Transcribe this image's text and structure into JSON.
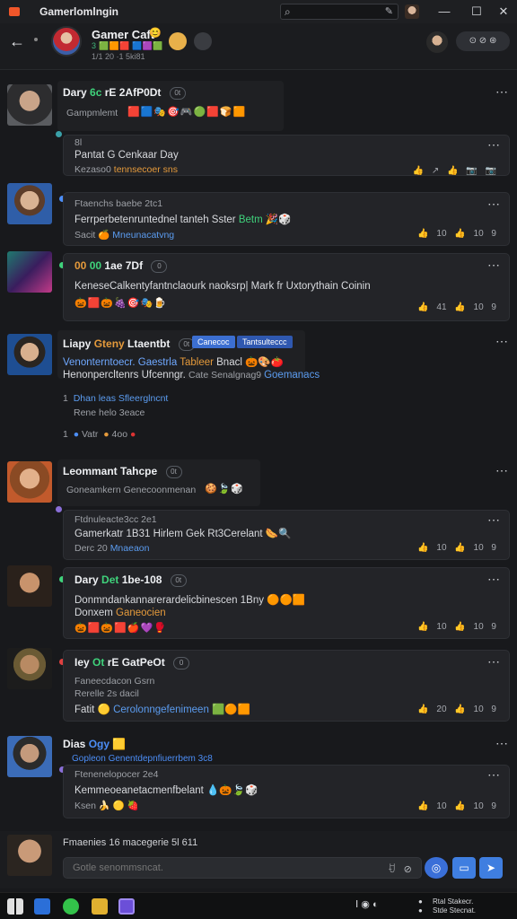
{
  "window": {
    "title": "Gamerlomlngin",
    "search_icon": "search-icon",
    "minimize": "—",
    "maximize": "☐",
    "close": "✕"
  },
  "header": {
    "back": "←",
    "group_name": "Gamer Caft",
    "group_emoji": "😊",
    "group_status": "3 🟩🟧🟥 🟦🟪🟩",
    "group_members": "1/1 20 ·1 5ki81",
    "pill": "⊙ ⊘ ⊛"
  },
  "messages": [
    {
      "name": "Dary",
      "name_green": "6c",
      "name_rest": "rE 2AfP0Dt",
      "time": "0t",
      "text": "Gampmlemt",
      "emojis": "🟥🟦🎭🎯🎮🟢🟥🍞🟧",
      "replies": [
        {
          "meta": "8l",
          "line1": "Pantat  G  Cenkaar  Day",
          "line2": "Kezaso0 ",
          "line2_orange": "tennsecoer sns",
          "reactions": "👍 ↗ 👍 📷 📷"
        }
      ]
    },
    {
      "name": "",
      "text_meta": "Ftaenchs baebe 2tc1",
      "text": "Ferrperbetenruntednel tanteh Sster ",
      "text_green": "Betm",
      "text_emojis": "🎉🎲",
      "sub": "Sacit 🍊 ",
      "sub_blue": "Mneunacatvng",
      "reactions": "👍 10  👍 10  9"
    },
    {
      "name": "00",
      "name_green": "00",
      "name_rest": "1ae 7Df",
      "time": "0",
      "text": "KeneseCalkentyfantnclaourk naoksrp| Mark fr Uxtorythain Coinin",
      "emojis": "🎃🟥🎃🍇🎯🎭🍺",
      "reactions": "👍 41  👍 10  9"
    },
    {
      "name": "Liapy",
      "name_green": "Gteny",
      "name_rest": "Ltaentbt",
      "time": "0t",
      "tags": [
        "Canecoc",
        "Tantsulteccc"
      ],
      "text": "Venonterntoecr. Gaestrla ",
      "text_orange": "Tableer",
      "text_tail": " Bnacl",
      "text_emojis": "🎃🎨🍅",
      "text2": "Henonpercltenrs Ufcenngr. ",
      "text2_gray": "Cate Senalgnag9 ",
      "text2_blue": "Goemanacs",
      "line3_num": "1",
      "line3": "Dhan leas Sfleerglncnt",
      "line4": "Rene helo 3eace",
      "line5_num": "1",
      "line5_a": "Vatr",
      "line5_b": "4oo"
    },
    {
      "name": "Leommant",
      "name_rest": "Tahcpe",
      "time": "0t",
      "text": "Goneamkern Genecoonmenan",
      "emojis": "🍪🍃🎲",
      "replies": [
        {
          "meta": "Ftdnuleacte3cc 2e1",
          "line1": "Gamerkatr 1B31 Hirlem Gek Rt3Cerelant",
          "line1_emojis": "🌭🔍",
          "line2": "Derc 20 ",
          "line2_blue": "Mnaeaon",
          "reactions": "👍 10  👍 10  9"
        }
      ]
    },
    {
      "name": "Dary",
      "name_green": "Det",
      "name_rest": "1be-108",
      "time": "0t",
      "text": "Donmndankannarerardelicbinescen 1Bny",
      "text_emojis": "🟠🟠🟧",
      "sub": "Donxem ",
      "sub_blue": "Ganeocien",
      "emojis": "🎃🟥🎃🟥🍎💜🥊",
      "reactions": "👍 10  👍 10  9"
    },
    {
      "name": "Iey",
      "name_green": "Ot",
      "name_rest": "rE GatPeOt",
      "time": "0",
      "text": "Faneecdacon Gsrn",
      "text2": "Rerelle 2s dacil",
      "text3": "Fatit 🟡 ",
      "text3_blue": "Cerolonngefenimeen",
      "text3_emojis": "🟩🟠🟧",
      "reactions": "👍 20  👍 10  9"
    },
    {
      "name": "Dias",
      "name_blue": "Ogy",
      "name_emoji": "🟨",
      "sub_blue": "Gopleon Genentdepnfiuerrbem 3c8",
      "replies": [
        {
          "meta": "Ftenenelopocer 2e4",
          "line1": "Kemmeoeanetacmenfbelant",
          "line1_emojis": "💧🎃🍃🎲",
          "line2": "Ksen 🍌 🟡 🍓",
          "reactions": "👍 10  👍 10  9"
        }
      ]
    }
  ],
  "composer": {
    "label": "Fmaenies 16 macegerie 5l 611",
    "placeholder": "Gotle senommsncat.",
    "icons": "ꀀ ⊘"
  },
  "tray": {
    "line1": "Rtal Stakecr.",
    "line2": "Stde Stecnat."
  },
  "colors": {
    "background": "#18191c",
    "accent_blue": "#4c8ef7",
    "accent_green": "#3fd27b",
    "accent_orange": "#e59a3b"
  }
}
